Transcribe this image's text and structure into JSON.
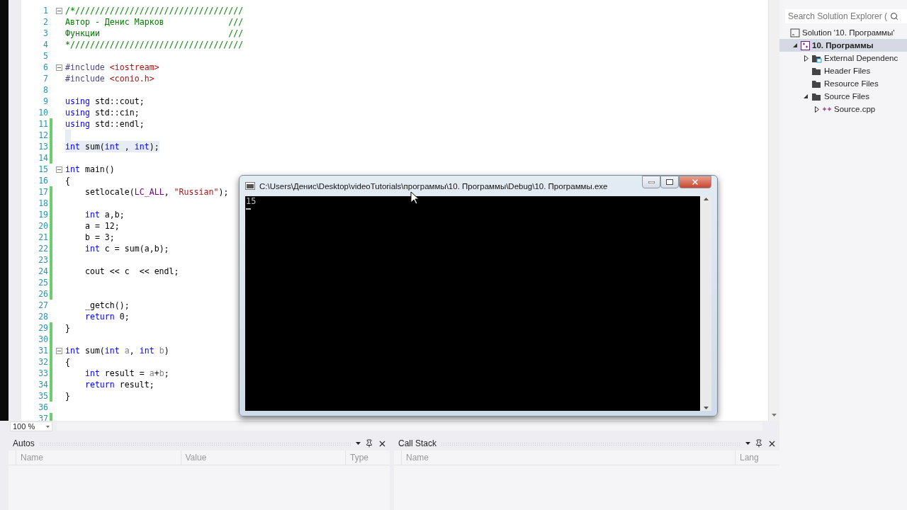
{
  "editor": {
    "zoom": "100 %",
    "lines": [
      {
        "n": "1",
        "fold": true,
        "changed": false,
        "selected": false,
        "tokens": [
          {
            "kind": "comment",
            "text": "/*//////////////////////////////////"
          }
        ]
      },
      {
        "n": "2",
        "fold": false,
        "changed": false,
        "selected": false,
        "tokens": [
          {
            "kind": "comment",
            "text": "Автор - Денис Марков             ///"
          }
        ]
      },
      {
        "n": "3",
        "fold": false,
        "changed": false,
        "selected": false,
        "tokens": [
          {
            "kind": "comment",
            "text": "Функции                          ///"
          }
        ]
      },
      {
        "n": "4",
        "fold": false,
        "changed": false,
        "selected": false,
        "tokens": [
          {
            "kind": "comment",
            "text": "*///////////////////////////////////"
          }
        ]
      },
      {
        "n": "5",
        "fold": false,
        "changed": false,
        "selected": false
      },
      {
        "n": "6",
        "fold": true,
        "changed": false,
        "selected": false,
        "tokens": [
          {
            "kind": "preproc",
            "text": "#include"
          },
          {
            "kind": "string",
            "text": " <iostream>"
          }
        ]
      },
      {
        "n": "7",
        "fold": false,
        "changed": false,
        "selected": false,
        "tokens": [
          {
            "kind": "preproc",
            "text": "#include"
          },
          {
            "kind": "string",
            "text": " <conio.h>"
          }
        ]
      },
      {
        "n": "8",
        "fold": false,
        "changed": false,
        "selected": false
      },
      {
        "n": "9",
        "fold": false,
        "changed": false,
        "selected": false,
        "tokens": [
          {
            "kind": "keyword",
            "text": "using"
          },
          {
            "kind": "plain",
            "text": " std::cout;"
          }
        ]
      },
      {
        "n": "10",
        "fold": false,
        "changed": false,
        "selected": false,
        "tokens": [
          {
            "kind": "keyword",
            "text": "using"
          },
          {
            "kind": "plain",
            "text": " std::cin;"
          }
        ]
      },
      {
        "n": "11",
        "fold": false,
        "changed": true,
        "selected": false,
        "tokens": [
          {
            "kind": "keyword",
            "text": "using"
          },
          {
            "kind": "plain",
            "text": " std::endl;"
          }
        ]
      },
      {
        "n": "12",
        "fold": false,
        "changed": true,
        "selected": true
      },
      {
        "n": "13",
        "fold": false,
        "changed": true,
        "selected": true,
        "tokens": [
          {
            "kind": "keyword",
            "text": "int"
          },
          {
            "kind": "plain",
            "text": " sum("
          },
          {
            "kind": "keyword",
            "text": "int"
          },
          {
            "kind": "plain",
            "text": " , "
          },
          {
            "kind": "keyword",
            "text": "int"
          },
          {
            "kind": "plain",
            "text": ");"
          }
        ]
      },
      {
        "n": "14",
        "fold": false,
        "changed": true,
        "selected": false
      },
      {
        "n": "15",
        "fold": true,
        "changed": false,
        "selected": false,
        "tokens": [
          {
            "kind": "keyword",
            "text": "int"
          },
          {
            "kind": "plain",
            "text": " main()"
          }
        ]
      },
      {
        "n": "16",
        "fold": false,
        "changed": false,
        "selected": false,
        "tokens": [
          {
            "kind": "plain",
            "text": "{"
          }
        ]
      },
      {
        "n": "17",
        "fold": false,
        "changed": true,
        "selected": false,
        "tokens": [
          {
            "kind": "plain",
            "text": "    setlocale("
          },
          {
            "kind": "macro",
            "text": "LC_ALL"
          },
          {
            "kind": "plain",
            "text": ", "
          },
          {
            "kind": "string",
            "text": "\"Russian\""
          },
          {
            "kind": "plain",
            "text": ");"
          }
        ]
      },
      {
        "n": "18",
        "fold": false,
        "changed": true,
        "selected": false
      },
      {
        "n": "19",
        "fold": false,
        "changed": true,
        "selected": false,
        "tokens": [
          {
            "kind": "keyword",
            "text": "    int"
          },
          {
            "kind": "plain",
            "text": " a,b;"
          }
        ]
      },
      {
        "n": "20",
        "fold": false,
        "changed": true,
        "selected": false,
        "tokens": [
          {
            "kind": "plain",
            "text": "    a = 12;"
          }
        ]
      },
      {
        "n": "21",
        "fold": false,
        "changed": true,
        "selected": false,
        "tokens": [
          {
            "kind": "plain",
            "text": "    b = 3;"
          }
        ]
      },
      {
        "n": "22",
        "fold": false,
        "changed": true,
        "selected": false,
        "tokens": [
          {
            "kind": "keyword",
            "text": "    int"
          },
          {
            "kind": "plain",
            "text": " c = sum(a,b);"
          }
        ]
      },
      {
        "n": "23",
        "fold": false,
        "changed": true,
        "selected": false
      },
      {
        "n": "24",
        "fold": false,
        "changed": true,
        "selected": false,
        "tokens": [
          {
            "kind": "plain",
            "text": "    cout << c  << endl;"
          }
        ]
      },
      {
        "n": "25",
        "fold": false,
        "changed": true,
        "selected": false
      },
      {
        "n": "26",
        "fold": false,
        "changed": true,
        "selected": false
      },
      {
        "n": "27",
        "fold": false,
        "changed": false,
        "selected": false,
        "tokens": [
          {
            "kind": "plain",
            "text": "    _getch();"
          }
        ]
      },
      {
        "n": "28",
        "fold": false,
        "changed": false,
        "selected": false,
        "tokens": [
          {
            "kind": "keyword",
            "text": "    return"
          },
          {
            "kind": "plain",
            "text": " 0;"
          }
        ]
      },
      {
        "n": "29",
        "fold": false,
        "changed": true,
        "selected": false,
        "tokens": [
          {
            "kind": "plain",
            "text": "}"
          }
        ]
      },
      {
        "n": "30",
        "fold": false,
        "changed": true,
        "selected": false
      },
      {
        "n": "31",
        "fold": true,
        "changed": true,
        "selected": false,
        "tokens": [
          {
            "kind": "keyword",
            "text": "int"
          },
          {
            "kind": "plain",
            "text": " sum("
          },
          {
            "kind": "keyword",
            "text": "int "
          },
          {
            "kind": "param",
            "text": "a"
          },
          {
            "kind": "plain",
            "text": ", "
          },
          {
            "kind": "keyword",
            "text": "int "
          },
          {
            "kind": "param",
            "text": "b"
          },
          {
            "kind": "plain",
            "text": ")"
          }
        ]
      },
      {
        "n": "32",
        "fold": false,
        "changed": true,
        "selected": false,
        "tokens": [
          {
            "kind": "plain",
            "text": "{"
          }
        ]
      },
      {
        "n": "33",
        "fold": false,
        "changed": true,
        "selected": false,
        "tokens": [
          {
            "kind": "keyword",
            "text": "    int"
          },
          {
            "kind": "plain",
            "text": " result = "
          },
          {
            "kind": "param",
            "text": "a"
          },
          {
            "kind": "plain",
            "text": "+"
          },
          {
            "kind": "param",
            "text": "b"
          },
          {
            "kind": "plain",
            "text": ";"
          }
        ]
      },
      {
        "n": "34",
        "fold": false,
        "changed": true,
        "selected": false,
        "tokens": [
          {
            "kind": "keyword",
            "text": "    return"
          },
          {
            "kind": "plain",
            "text": " result;"
          }
        ]
      },
      {
        "n": "35",
        "fold": false,
        "changed": true,
        "selected": false,
        "tokens": [
          {
            "kind": "plain",
            "text": "}"
          }
        ]
      },
      {
        "n": "36",
        "fold": false,
        "changed": false,
        "selected": false
      },
      {
        "n": "37",
        "fold": false,
        "changed": true,
        "selected": false
      }
    ]
  },
  "console": {
    "title": "C:\\Users\\Денис\\Desktop\\videoTutorials\\программы\\10. Программы\\Debug\\10. Программы.exe",
    "output": [
      "15"
    ]
  },
  "solution_explorer": {
    "search": {
      "placeholder": "Search Solution Explorer ("
    },
    "tree": [
      {
        "label": "Solution '10. Программы'",
        "kind": "solution",
        "selected": false,
        "children": [
          {
            "label": "10. Программы",
            "kind": "project",
            "selected": true,
            "expanded": true,
            "children": [
              {
                "label": "External Dependenc",
                "kind": "external",
                "selected": false,
                "expanded": false
              },
              {
                "label": "Header Files",
                "kind": "filter",
                "selected": false
              },
              {
                "label": "Resource Files",
                "kind": "filter",
                "selected": false
              },
              {
                "label": "Source Files",
                "kind": "filter",
                "selected": false,
                "expanded": true,
                "children": [
                  {
                    "label": "Source.cpp",
                    "kind": "cpp",
                    "selected": false,
                    "expanded": false
                  }
                ]
              }
            ]
          }
        ]
      }
    ]
  },
  "bottom_panels": [
    {
      "title": "Autos",
      "columns": [
        "Name",
        "Value",
        "Type"
      ]
    },
    {
      "title": "Call Stack",
      "columns": [
        "Name",
        "Lang"
      ]
    }
  ]
}
